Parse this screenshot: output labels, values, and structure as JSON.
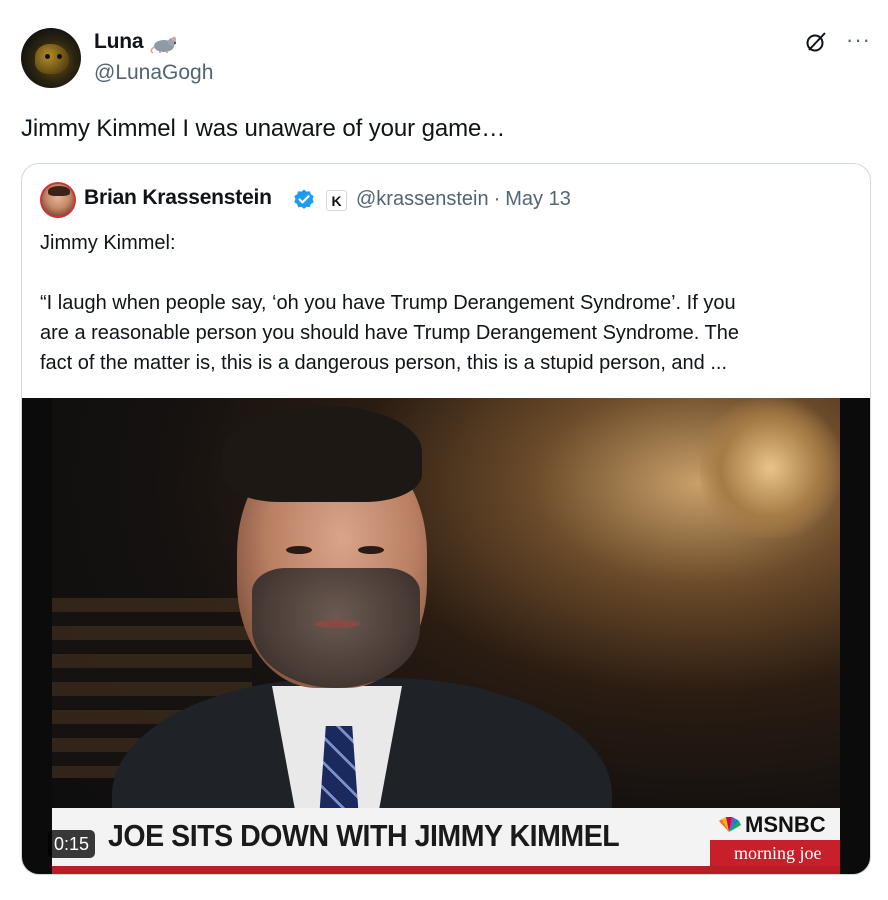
{
  "post": {
    "author_name": "Luna",
    "author_handle": "@LunaGogh",
    "author_badge_icon": "rat-icon",
    "text": "Jimmy Kimmel I was unaware of your game…"
  },
  "actions": {
    "grok_icon": "grok-icon",
    "more_icon": "more-icon",
    "more_glyph": "···"
  },
  "quote": {
    "author_name": "Brian Krassenstein",
    "verified_icon": "verified-badge-icon",
    "affiliation_letter": "K",
    "author_handle": "@krassenstein",
    "separator": "·",
    "date": "May 13",
    "lines": [
      "Jimmy Kimmel:",
      "",
      "“I laugh when people say, ‘oh you have Trump Derangement Syndrome’. If you",
      "are a reasonable person you should have Trump Derangement Syndrome. The",
      "fact of the matter is, this is a dangerous person, this is a stupid person, and ..."
    ]
  },
  "video": {
    "duration": "0:15",
    "lower_third": "JOE SITS DOWN WITH JIMMY KIMMEL",
    "network": "MSNBC",
    "show": "morning joe"
  },
  "colors": {
    "text": "#0f1419",
    "secondary": "#536471",
    "border": "#cfd9de",
    "verified": "#1d9bf0",
    "msnbc_red": "#c8202a"
  }
}
